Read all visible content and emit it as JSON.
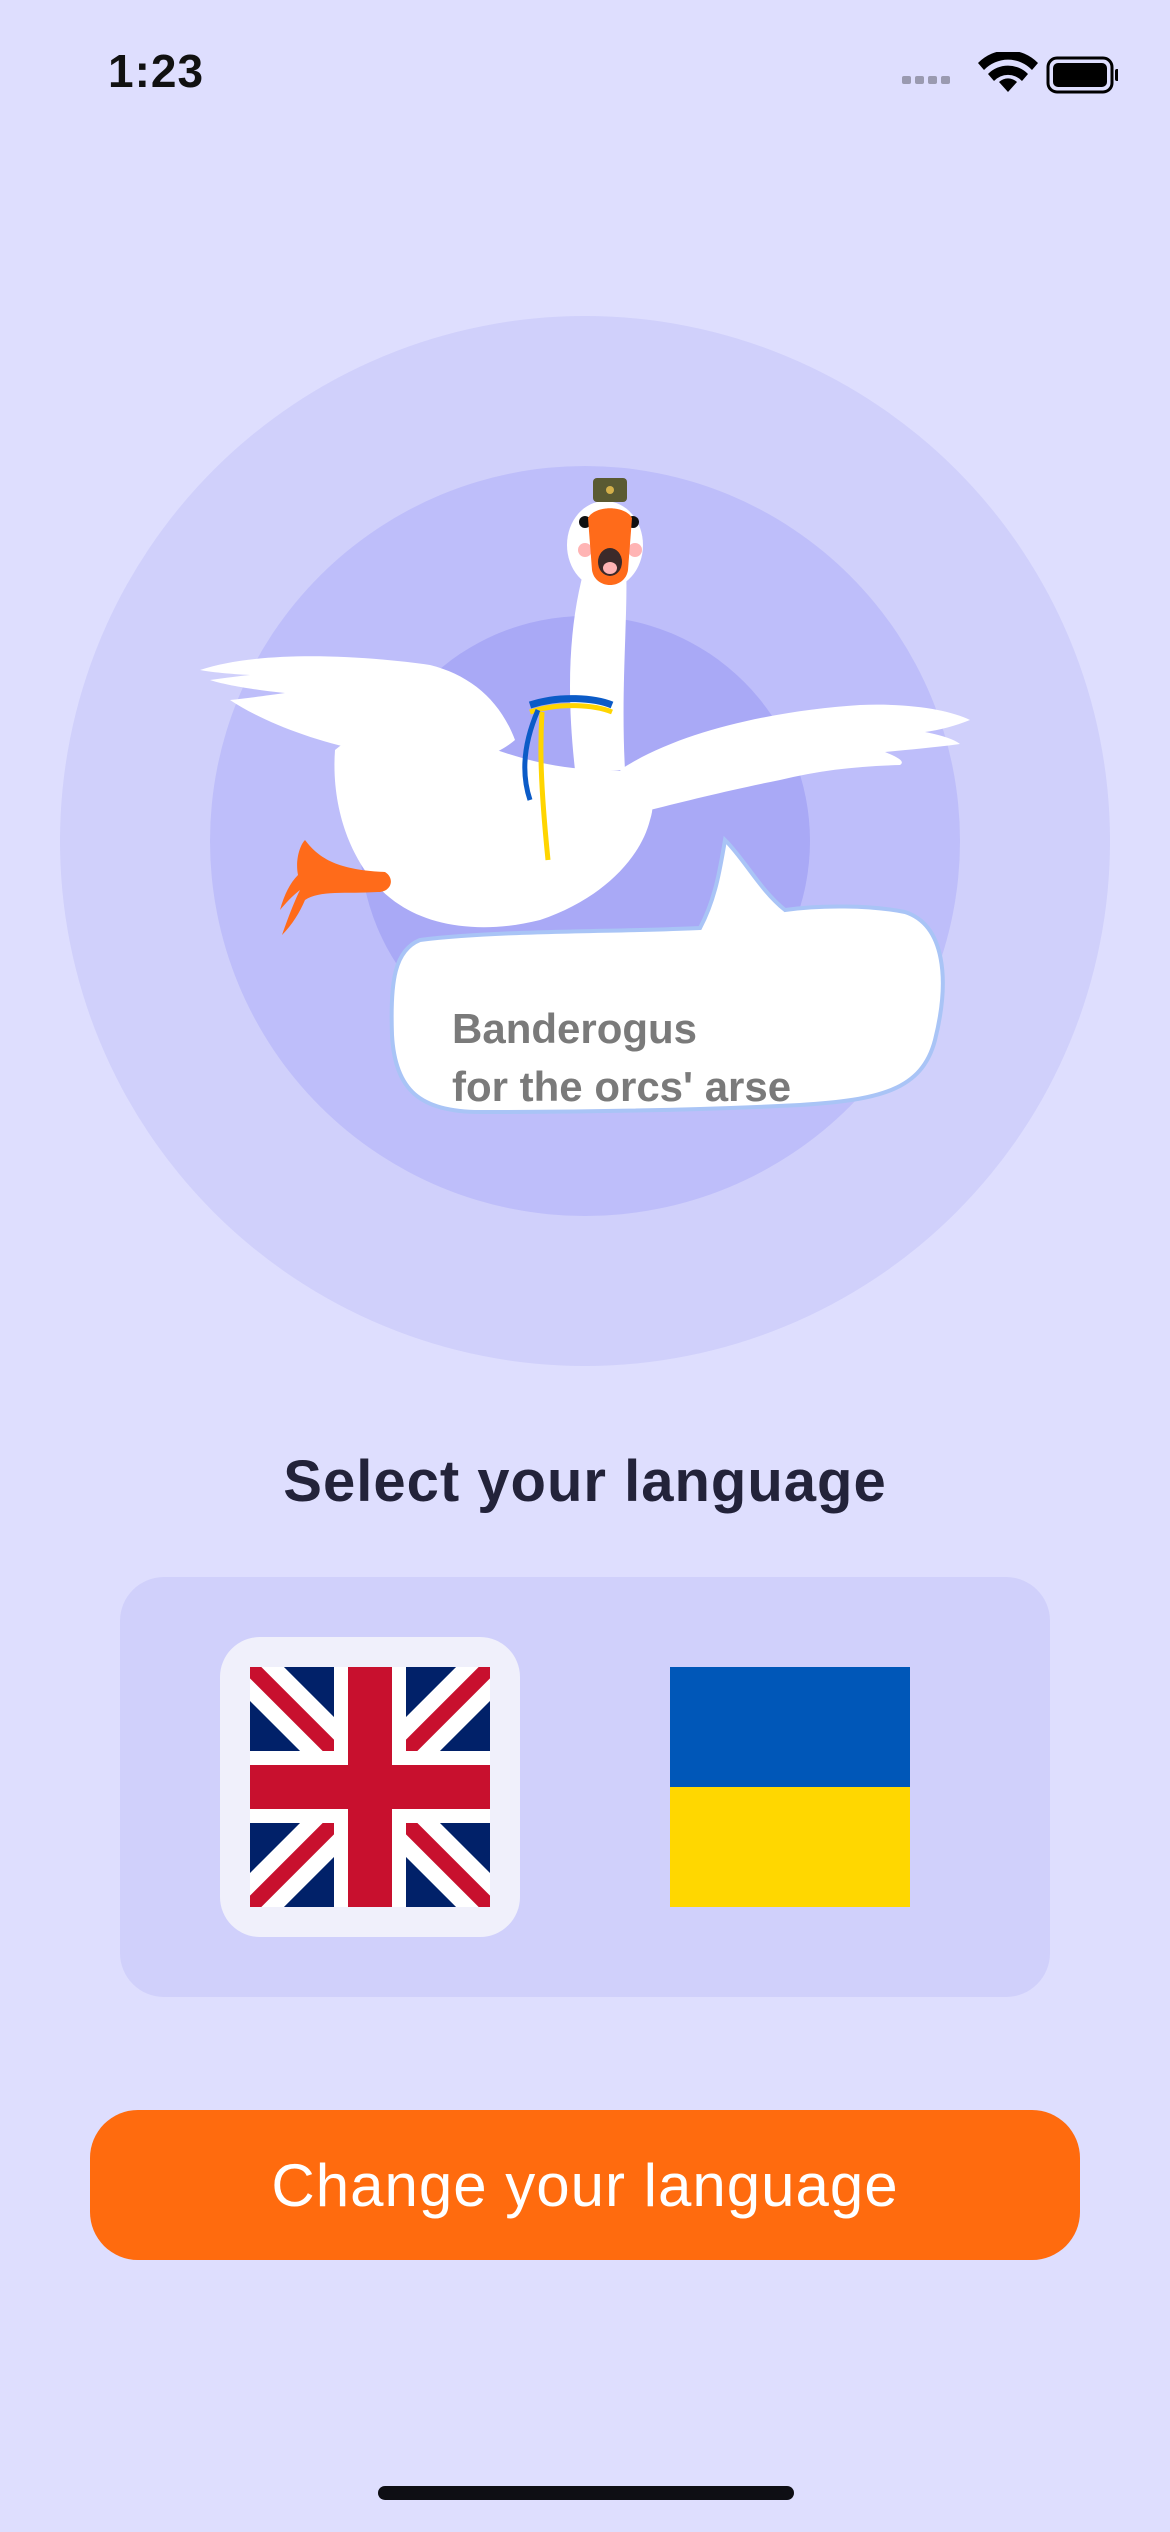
{
  "status_bar": {
    "time": "1:23",
    "icons": [
      "signal-icon",
      "wifi-icon",
      "battery-icon"
    ]
  },
  "hero": {
    "illustration": "goose-icon",
    "speech_bubble": {
      "line1": "Banderogus",
      "line2": "for the orcs' arse"
    }
  },
  "language_select": {
    "title": "Select your language",
    "options": [
      {
        "id": "en",
        "flag": "uk-flag-icon",
        "selected": true
      },
      {
        "id": "uk",
        "flag": "ukraine-flag-icon",
        "selected": false
      }
    ]
  },
  "cta": {
    "label": "Change your language"
  },
  "colors": {
    "background": "#dedefe",
    "accent": "#ff6b0e",
    "panel": "#d0d0fb",
    "title_text": "#23233a"
  }
}
